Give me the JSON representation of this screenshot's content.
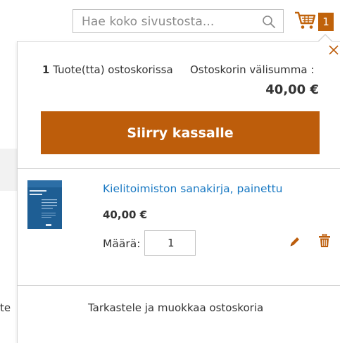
{
  "header": {
    "search": {
      "placeholder": "Hae koko sivustosta..."
    },
    "cart": {
      "count": "1"
    }
  },
  "background": {
    "partial_text": "te"
  },
  "minicart": {
    "items_count_number": "1",
    "items_count_text": " Tuote(tta) ostoskorissa",
    "subtotal_label": "Ostoskorin välisumma :",
    "subtotal_value": "40,00 €",
    "checkout_label": "Siirry kassalle",
    "items": [
      {
        "name": "Kielitoimiston sanakirja, painettu",
        "price": "40,00 €",
        "qty_label": "Määrä:",
        "qty": "1",
        "image_title": "Kielitoimiston sanakirja"
      }
    ],
    "view_cart_label": "Tarkastele ja muokkaa ostoskoria"
  },
  "colors": {
    "accent": "#bd5d0b",
    "link": "#1979c3",
    "text": "#333333"
  }
}
